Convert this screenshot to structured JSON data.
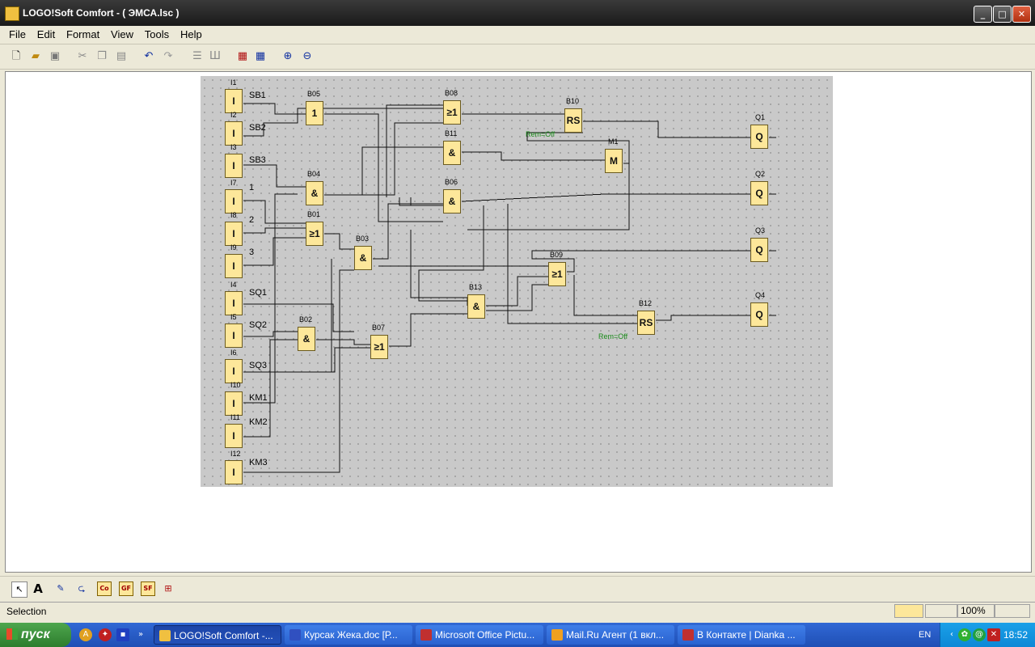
{
  "window": {
    "title": "LOGO!Soft Comfort  - ( ЭМСА.lsc )"
  },
  "menu": [
    "File",
    "Edit",
    "Format",
    "View",
    "Tools",
    "Help"
  ],
  "toolbar_icons": [
    "new-icon",
    "open-icon",
    "save-icon",
    "cut-icon",
    "copy-icon",
    "paste-icon",
    "undo-icon",
    "redo-icon",
    "align-icon",
    "align2-icon",
    "simulate-icon",
    "transfer-icon",
    "zoom-in-icon",
    "zoom-out-icon"
  ],
  "diagram": {
    "inputs": [
      {
        "id": "I1",
        "tag": "SB1",
        "sym": "I"
      },
      {
        "id": "I2",
        "tag": "SB2",
        "sym": "I"
      },
      {
        "id": "I3",
        "tag": "SB3",
        "sym": "I"
      },
      {
        "id": "I7",
        "tag": "1",
        "sym": "I"
      },
      {
        "id": "I8",
        "tag": "2",
        "sym": "I"
      },
      {
        "id": "I9",
        "tag": "3",
        "sym": "I"
      },
      {
        "id": "I4",
        "tag": "SQ1",
        "sym": "I"
      },
      {
        "id": "I5",
        "tag": "SQ2",
        "sym": "I"
      },
      {
        "id": "I6",
        "tag": "SQ3",
        "sym": "I"
      },
      {
        "id": "I10",
        "tag": "KM1",
        "sym": "I"
      },
      {
        "id": "I11",
        "tag": "KM2",
        "sym": "I"
      },
      {
        "id": "I12",
        "tag": "KM3",
        "sym": "I"
      }
    ],
    "blocks": [
      {
        "id": "B05",
        "sym": "1"
      },
      {
        "id": "B04",
        "sym": "&"
      },
      {
        "id": "B01",
        "sym": "≥1"
      },
      {
        "id": "B03",
        "sym": "&"
      },
      {
        "id": "B02",
        "sym": "&"
      },
      {
        "id": "B07",
        "sym": "≥1"
      },
      {
        "id": "B08",
        "sym": "≥1"
      },
      {
        "id": "B11",
        "sym": "&"
      },
      {
        "id": "B06",
        "sym": "&"
      },
      {
        "id": "B13",
        "sym": "&"
      },
      {
        "id": "B10",
        "sym": "RS"
      },
      {
        "id": "M1",
        "sym": "M"
      },
      {
        "id": "B09",
        "sym": "≥1"
      },
      {
        "id": "B12",
        "sym": "RS"
      },
      {
        "id": "Q1",
        "sym": "Q"
      },
      {
        "id": "Q2",
        "sym": "Q"
      },
      {
        "id": "Q3",
        "sym": "Q"
      },
      {
        "id": "Q4",
        "sym": "Q"
      }
    ],
    "rem_labels": [
      "Rem=Off",
      "Rem=Off"
    ]
  },
  "bottom_tools": [
    "selection-icon",
    "text-icon",
    "connect-icon",
    "cut-connection-icon",
    "Co",
    "GF",
    "SF",
    "network-icon"
  ],
  "status": {
    "text": "Selection",
    "zoom": "100%"
  },
  "taskbar": {
    "start": "пуск",
    "tasks": [
      {
        "label": "LOGO!Soft Comfort -...",
        "color": "#f0c040"
      },
      {
        "label": "Курсак Жека.doc [Р...",
        "color": "#3050c0"
      },
      {
        "label": "Microsoft Office Pictu...",
        "color": "#c03030"
      },
      {
        "label": "Mail.Ru Агент (1 вкл...",
        "color": "#f0a020"
      },
      {
        "label": "В Контакте | Dianka ...",
        "color": "#c03030"
      }
    ],
    "lang": "EN",
    "clock": "18:52"
  }
}
